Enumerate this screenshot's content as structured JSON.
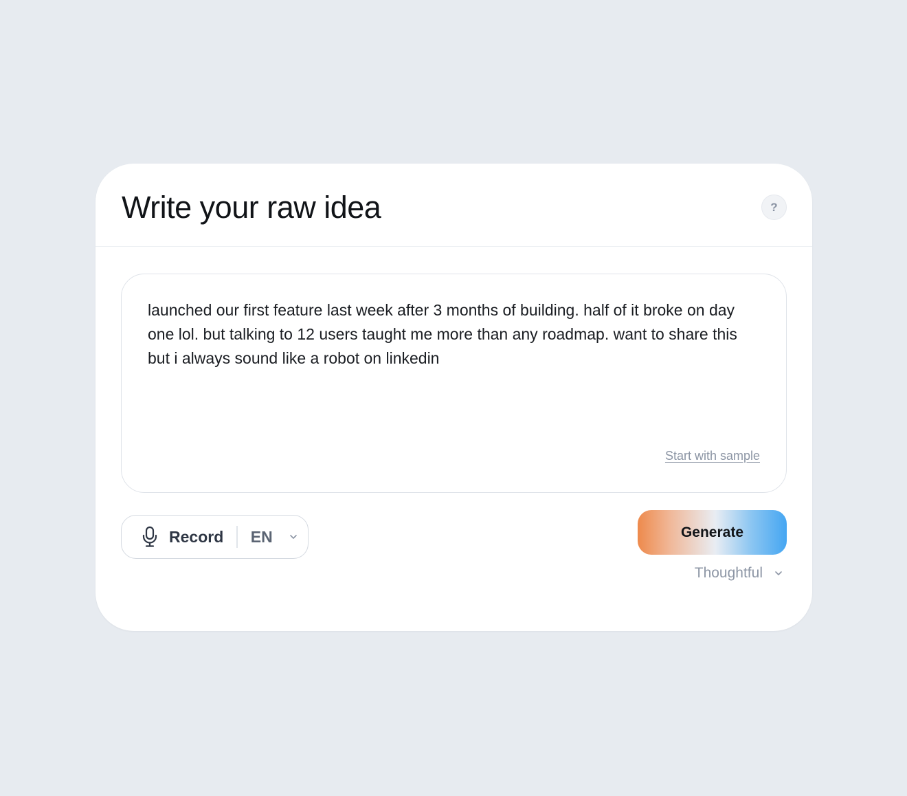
{
  "panel": {
    "title": "Write your raw idea",
    "help_label": "?"
  },
  "idea": {
    "text": "launched our first feature last week after 3 months of building. half of it broke on day one lol. but talking to 12 users taught me more than any roadmap. want to share this but i always sound like a robot on linkedin",
    "sample_link": "Start with sample"
  },
  "controls": {
    "record_label": "Record",
    "mic_icon": "microphone-icon",
    "language": "EN",
    "generate_label": "Generate",
    "tone": "Thoughtful",
    "chevron_icon": "chevron-down-icon"
  },
  "colors": {
    "background": "#e7ebf0",
    "card": "#ffffff",
    "gradient_start": "#ee8a4c",
    "gradient_end": "#45a6f2"
  }
}
